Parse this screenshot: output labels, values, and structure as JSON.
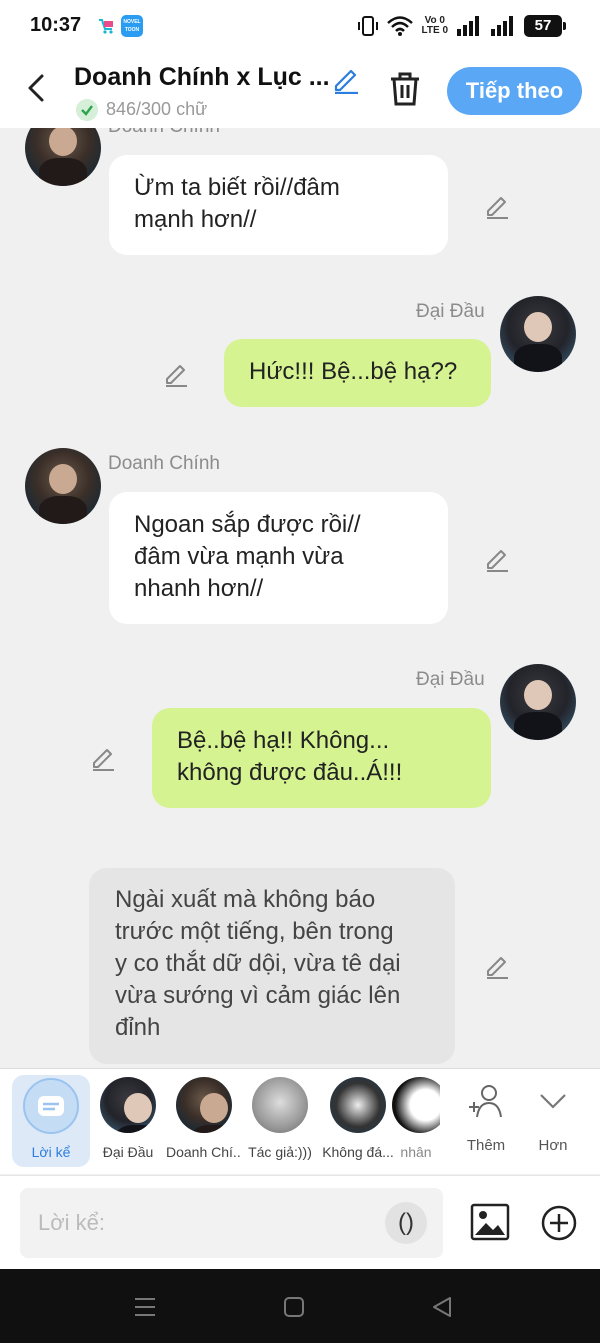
{
  "status_bar": {
    "time": "10:37",
    "app_label_1": "NOVEL",
    "app_label_2": "TOON",
    "net_top": "Vo 0",
    "net_bottom": "LTE 0",
    "battery": "57"
  },
  "header": {
    "title": "Doanh Chính x Lục ...",
    "word_count": "846/300 chữ",
    "next_label": "Tiếp theo"
  },
  "messages": [
    {
      "kind": "left",
      "name": "Doanh Chính",
      "text_lines": [
        "Ừm ta biết rồi//đâm",
        "mạnh hơn//"
      ]
    },
    {
      "kind": "right",
      "name": "Đại Đầu",
      "text_lines": [
        "Hức!!! Bệ...bệ hạ??"
      ]
    },
    {
      "kind": "left",
      "name": "Doanh Chính",
      "text_lines": [
        "Ngoan sắp được rồi//",
        "đâm vừa mạnh vừa",
        "nhanh hơn//"
      ]
    },
    {
      "kind": "right",
      "name": "Đại Đầu",
      "text_lines": [
        "Bệ..bệ hạ!! Không...",
        "không được đâu..Á!!!"
      ]
    },
    {
      "kind": "narration",
      "text_lines": [
        "Ngài xuất mà không báo",
        "trước một tiếng, bên trong",
        "y co thắt dữ dội, vừa tê dại",
        "vừa sướng vì cảm giác lên",
        "đỉnh"
      ]
    }
  ],
  "character_bar": {
    "narrator_label": "Lời kể",
    "characters": [
      "Đại Đầu",
      "Doanh Chí...",
      "Tác giả:)))",
      "Không đá...",
      "nhân"
    ],
    "add_label": "Thêm",
    "more_label": "Hơn"
  },
  "input": {
    "placeholder": "Lời kể:",
    "paren": "()"
  },
  "colors": {
    "accent": "#5aa7f5",
    "my_bubble": "#d6f391",
    "narration_bubble": "#e5e5e5",
    "link_blue": "#2b7de0"
  },
  "icons": [
    "back-arrow-icon",
    "pencil-icon",
    "check-icon",
    "trash-icon",
    "person-plus-icon",
    "chevron-down-icon",
    "image-icon",
    "plus-circle-icon",
    "menu-icon",
    "home-icon",
    "back-triangle-icon"
  ]
}
